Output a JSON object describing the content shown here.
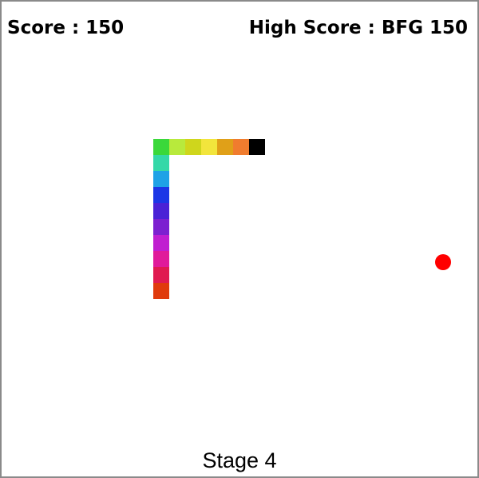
{
  "hud": {
    "score_label": "Score : 150",
    "high_score_label": "High Score : BFG 150"
  },
  "stage": {
    "label": "Stage 4"
  },
  "snake": {
    "segments": [
      {
        "col": 16,
        "row": 9,
        "color": "#000000"
      },
      {
        "col": 15,
        "row": 9,
        "color": "#f07c2e"
      },
      {
        "col": 14,
        "row": 9,
        "color": "#e0a018"
      },
      {
        "col": 13,
        "row": 9,
        "color": "#f2e53c"
      },
      {
        "col": 12,
        "row": 9,
        "color": "#cfd61c"
      },
      {
        "col": 11,
        "row": 9,
        "color": "#b8ea3c"
      },
      {
        "col": 10,
        "row": 9,
        "color": "#3ad83a"
      },
      {
        "col": 10,
        "row": 10,
        "color": "#34d8a8"
      },
      {
        "col": 10,
        "row": 11,
        "color": "#1ea2e6"
      },
      {
        "col": 10,
        "row": 12,
        "color": "#1c36e6"
      },
      {
        "col": 10,
        "row": 13,
        "color": "#4a22d6"
      },
      {
        "col": 10,
        "row": 14,
        "color": "#7c20d0"
      },
      {
        "col": 10,
        "row": 15,
        "color": "#c01ed0"
      },
      {
        "col": 10,
        "row": 16,
        "color": "#e01a9a"
      },
      {
        "col": 10,
        "row": 17,
        "color": "#e01a50"
      },
      {
        "col": 10,
        "row": 18,
        "color": "#e03a0c"
      }
    ]
  },
  "food": {
    "col": 28,
    "row": 16,
    "color": "#ff0000"
  }
}
